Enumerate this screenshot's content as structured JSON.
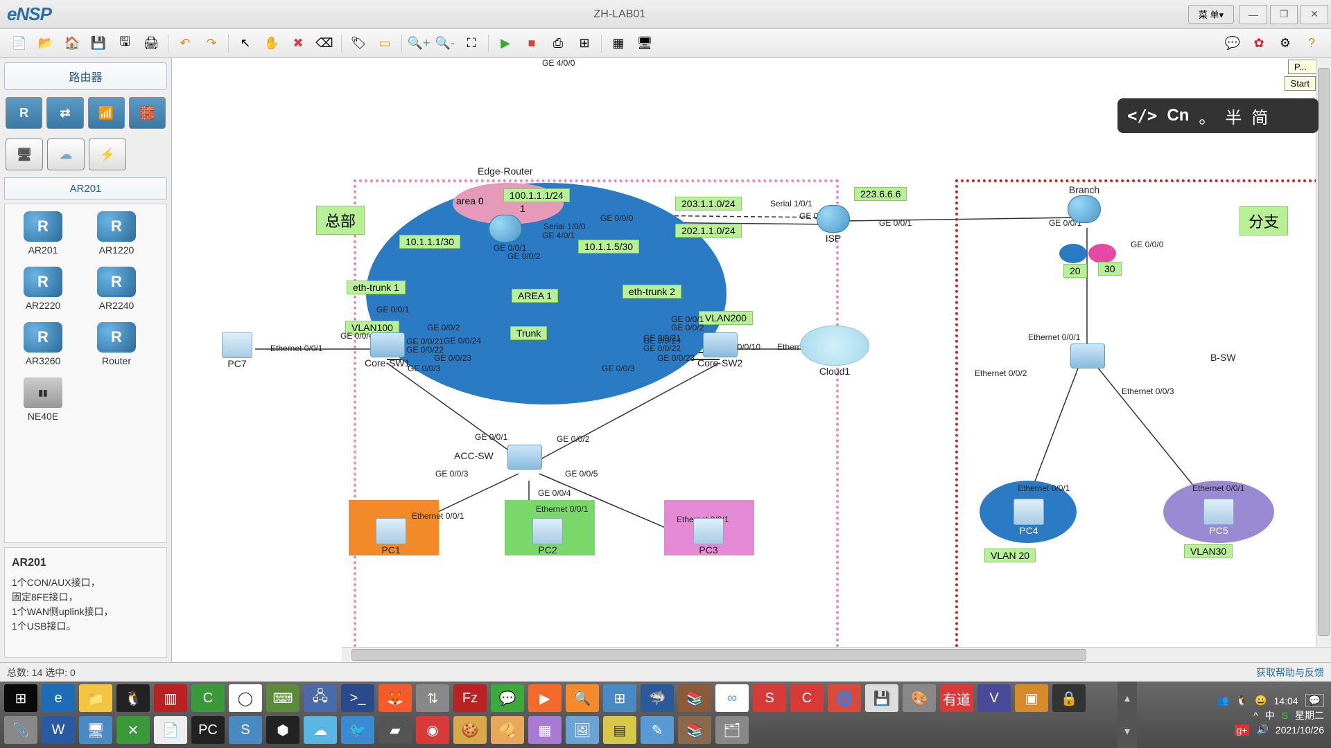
{
  "app": {
    "logo": "eNSP",
    "title": "ZH-LAB01",
    "menu": "菜 单",
    "tooltip": "Start",
    "tooltip_pfx": "P..."
  },
  "winbtns": {
    "min": "—",
    "max": "❐",
    "close": "✕"
  },
  "left": {
    "tab": "路由器",
    "sub": "AR201",
    "devices": [
      "AR201",
      "AR1220",
      "AR2220",
      "AR2240",
      "AR3260",
      "Router",
      "NE40E"
    ],
    "desc_title": "AR201",
    "desc": "1个CON/AUX接口，\n固定8FE接口，\n1个WAN侧uplink接口，\n1个USB接口。"
  },
  "ime": {
    "code": "</>",
    "lang": "Cn",
    "dot": "。",
    "half": "半",
    "simp": "简"
  },
  "topo": {
    "zone_hq": "总部",
    "zone_branch": "分支",
    "edge_router": "Edge-Router",
    "isp": "ISP",
    "branch": "Branch",
    "bsw": "B-SW",
    "core1": "Core-SW1",
    "core2": "Core-SW2",
    "acc": "ACC-SW",
    "cloud1": "Cloud1",
    "pc1": "PC1",
    "pc2": "PC2",
    "pc3": "PC3",
    "pc4": "PC4",
    "pc5": "PC5",
    "pc7": "PC7",
    "area0": "area 0",
    "area1": "AREA 1",
    "eth1": "eth-trunk 1",
    "eth2": "eth-trunk 2",
    "trunk": "Trunk",
    "vlan100": "VLAN100",
    "vlan200": "VLAN200",
    "vlan20": "VLAN 20",
    "vlan30": "VLAN30",
    "n20": "20",
    "n30": "30",
    "ip_100": "100.1.1.1/24",
    "ip_101a": "10.1.1.1/30",
    "ip_101b": "10.1.1.5/30",
    "ip_203": "203.1.1.0/24",
    "ip_202": "202.1.1.0/24",
    "ip_223": "223.6.6.6",
    "serial10": "Serial 1/0/0",
    "serial11": "Serial 1/0/1",
    "ge40": "GE 4/0/0",
    "ge401": "GE 4/0/1",
    "ge000": "GE 0/0/0",
    "ge001": "GE 0/0/1",
    "ge002": "GE 0/0/2",
    "ge003": "GE 0/0/3",
    "ge004": "GE 0/0/4",
    "ge005": "GE 0/0/5",
    "ge0010": "GE 0/0/10",
    "ge0021": "GE 0/0/21",
    "ge0022": "GE 0/0/22",
    "ge0023": "GE 0/0/23",
    "ge0024": "GE 0/0/24",
    "e001": "Ethernet 0/0/1",
    "e002": "Ethernet 0/0/2",
    "e003": "Ethernet 0/0/3",
    "e004": "GE 0/0/4",
    "one": "1"
  },
  "status": {
    "left": "总数: 14 选中: 0",
    "right": "获取帮助与反馈"
  },
  "tray": {
    "time": "14:04",
    "day": "星期二",
    "date": "2021/10/26",
    "ime": "中",
    "snd": "🔊"
  }
}
